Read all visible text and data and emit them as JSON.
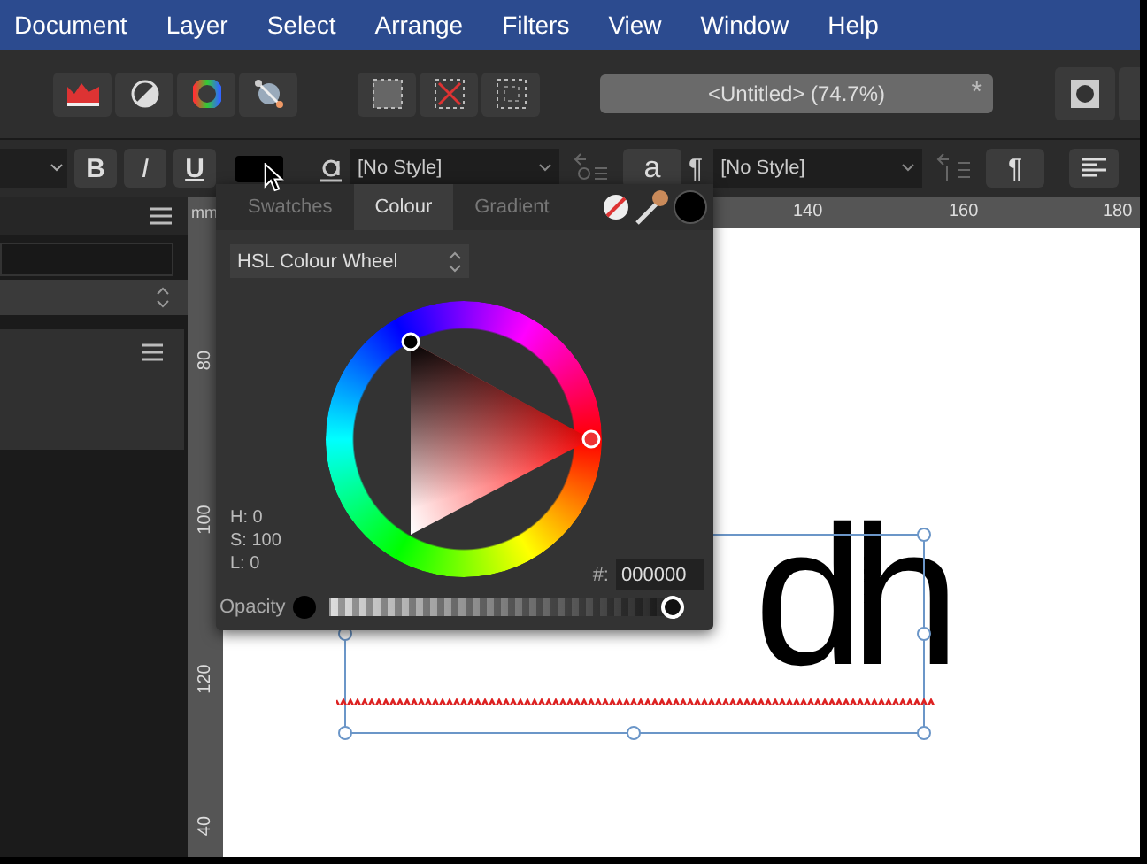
{
  "menu_bar": [
    "Document",
    "Layer",
    "Select",
    "Arrange",
    "Filters",
    "View",
    "Window",
    "Help"
  ],
  "toolbar": {
    "document_title": "<Untitled> (74.7%)",
    "modified_mark": "*"
  },
  "format_bar": {
    "bold": "B",
    "italic": "I",
    "underline": "U",
    "character_style": "[No Style]",
    "char_button": "a",
    "paragraph_mark": "¶",
    "paragraph_style": "[No Style]",
    "paragraph_button": "¶"
  },
  "rulers": {
    "unit": "mm",
    "horizontal": [
      {
        "label": "140"
      },
      {
        "label": "160"
      },
      {
        "label": "180"
      }
    ],
    "vertical": [
      {
        "label": "80"
      },
      {
        "label": "100"
      },
      {
        "label": "120"
      },
      {
        "label": "40"
      }
    ]
  },
  "colour_panel": {
    "tabs": [
      {
        "label": "Swatches",
        "selected": false
      },
      {
        "label": "Colour",
        "selected": true
      },
      {
        "label": "Gradient",
        "selected": false
      }
    ],
    "mode": "HSL Colour Wheel",
    "readouts": [
      "H: 0",
      "S: 100",
      "L: 0"
    ],
    "hex_label": "#:",
    "hex": "000000",
    "opacity_label": "Opacity",
    "opacity": {
      "level": 1
    }
  },
  "canvas": {
    "text": "dh"
  }
}
